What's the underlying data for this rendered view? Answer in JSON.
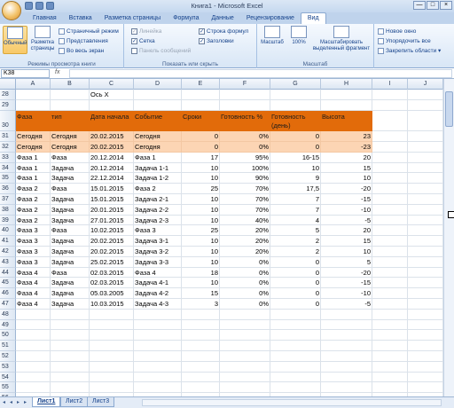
{
  "window": {
    "title": "Книга1 - Microsoft Excel",
    "controls": [
      "—",
      "□",
      "×"
    ]
  },
  "tabs": [
    "Главная",
    "Вставка",
    "Разметка страницы",
    "Формула",
    "Данные",
    "Рецензирование",
    "Вид"
  ],
  "active_tab": "Вид",
  "ribbon": {
    "views": {
      "normal": "Обычный",
      "page_layout": "Разметка страницы",
      "page_mode": "Страничный режим",
      "presentations": "Представления",
      "full_screen": "Во весь экран",
      "group": "Режимы просмотра книги"
    },
    "show": {
      "ruler": "Линейка",
      "grid": "Сетка",
      "messages": "Панель сообщений",
      "formula_bar": "Строка формул",
      "headings": "Заголовки",
      "group": "Показать или скрыть"
    },
    "zoom": {
      "zoom": "Масштаб",
      "hundred": "100%",
      "zoom_sel": "Масштабировать выделенный фрагмент",
      "group": "Масштаб"
    },
    "window": {
      "new": "Новое окно",
      "arrange": "Упорядочить все",
      "freeze": "Закрепить области ▾"
    }
  },
  "namebox": "K38",
  "columns": [
    "A",
    "B",
    "C",
    "D",
    "E",
    "F",
    "G",
    "H",
    "I",
    "J"
  ],
  "rows": [
    {
      "n": "28",
      "cells": [
        "",
        "",
        "Ось X",
        "",
        "",
        "",
        "",
        "",
        ""
      ],
      "style": ""
    },
    {
      "n": "29",
      "cells": [
        "",
        "",
        "",
        "",
        "",
        "",
        "",
        "",
        ""
      ],
      "style": ""
    },
    {
      "n": "30",
      "cells": [
        "Фаза",
        "тип",
        "Дата начала",
        "Событие",
        "Сроки",
        "Готовность %",
        "Готовность (день)",
        "Высота",
        ""
      ],
      "style": "hdr"
    },
    {
      "n": "31",
      "cells": [
        "Сегодня",
        "Сегодня",
        "20.02.2015",
        "Сегодня",
        "0",
        "0%",
        "0",
        "23",
        ""
      ],
      "style": "pk"
    },
    {
      "n": "32",
      "cells": [
        "Сегодня",
        "Сегодня",
        "20.02.2015",
        "Сегодня",
        "0",
        "0%",
        "0",
        "-23",
        ""
      ],
      "style": "pk"
    },
    {
      "n": "33",
      "cells": [
        "Фаза 1",
        "Фаза",
        "20.12.2014",
        "Фаза 1",
        "17",
        "95%",
        "16-15",
        "20",
        ""
      ],
      "style": ""
    },
    {
      "n": "34",
      "cells": [
        "Фаза 1",
        "Задача",
        "20.12.2014",
        "Задача 1-1",
        "10",
        "100%",
        "10",
        "15",
        ""
      ],
      "style": ""
    },
    {
      "n": "35",
      "cells": [
        "Фаза 1",
        "Задача",
        "22.12.2014",
        "Задача 1-2",
        "10",
        "90%",
        "9",
        "10",
        ""
      ],
      "style": ""
    },
    {
      "n": "36",
      "cells": [
        "Фаза 2",
        "Фаза",
        "15.01.2015",
        "Фаза 2",
        "25",
        "70%",
        "17,5",
        "-20",
        ""
      ],
      "style": ""
    },
    {
      "n": "37",
      "cells": [
        "Фаза 2",
        "Задача",
        "15.01.2015",
        "Задача 2-1",
        "10",
        "70%",
        "7",
        "-15",
        ""
      ],
      "style": ""
    },
    {
      "n": "38",
      "cells": [
        "Фаза 2",
        "Задача",
        "20.01.2015",
        "Задача 2-2",
        "10",
        "70%",
        "7",
        "-10",
        ""
      ],
      "style": ""
    },
    {
      "n": "39",
      "cells": [
        "Фаза 2",
        "Задача",
        "27.01.2015",
        "Задача 2-3",
        "10",
        "40%",
        "4",
        "-5",
        ""
      ],
      "style": ""
    },
    {
      "n": "40",
      "cells": [
        "Фаза 3",
        "Фаза",
        "10.02.2015",
        "Фаза 3",
        "25",
        "20%",
        "5",
        "20",
        ""
      ],
      "style": ""
    },
    {
      "n": "41",
      "cells": [
        "Фаза 3",
        "Задача",
        "20.02.2015",
        "Задача 3-1",
        "10",
        "20%",
        "2",
        "15",
        ""
      ],
      "style": ""
    },
    {
      "n": "42",
      "cells": [
        "Фаза 3",
        "Задача",
        "20.02.2015",
        "Задача 3-2",
        "10",
        "20%",
        "2",
        "10",
        ""
      ],
      "style": ""
    },
    {
      "n": "43",
      "cells": [
        "Фаза 3",
        "Задача",
        "25.02.2015",
        "Задача 3-3",
        "10",
        "0%",
        "0",
        "5",
        ""
      ],
      "style": ""
    },
    {
      "n": "44",
      "cells": [
        "Фаза 4",
        "Фаза",
        "02.03.2015",
        "Фаза 4",
        "18",
        "0%",
        "0",
        "-20",
        ""
      ],
      "style": ""
    },
    {
      "n": "45",
      "cells": [
        "Фаза 4",
        "Задача",
        "02.03.2015",
        "Задача 4-1",
        "10",
        "0%",
        "0",
        "-15",
        ""
      ],
      "style": ""
    },
    {
      "n": "46",
      "cells": [
        "Фаза 4",
        "Задача",
        "05.03.2005",
        "Задача 4-2",
        "15",
        "0%",
        "0",
        "-10",
        ""
      ],
      "style": ""
    },
    {
      "n": "47",
      "cells": [
        "Фаза 4",
        "Задача",
        "10.03.2015",
        "Задача 4-3",
        "3",
        "0%",
        "0",
        "-5",
        ""
      ],
      "style": ""
    },
    {
      "n": "48",
      "cells": [
        "",
        "",
        "",
        "",
        "",
        "",
        "",
        "",
        ""
      ],
      "style": ""
    },
    {
      "n": "49",
      "cells": [
        "",
        "",
        "",
        "",
        "",
        "",
        "",
        "",
        ""
      ],
      "style": ""
    },
    {
      "n": "50",
      "cells": [
        "",
        "",
        "",
        "",
        "",
        "",
        "",
        "",
        ""
      ],
      "style": ""
    },
    {
      "n": "51",
      "cells": [
        "",
        "",
        "",
        "",
        "",
        "",
        "",
        "",
        ""
      ],
      "style": ""
    },
    {
      "n": "52",
      "cells": [
        "",
        "",
        "",
        "",
        "",
        "",
        "",
        "",
        ""
      ],
      "style": ""
    },
    {
      "n": "53",
      "cells": [
        "",
        "",
        "",
        "",
        "",
        "",
        "",
        "",
        ""
      ],
      "style": ""
    },
    {
      "n": "54",
      "cells": [
        "",
        "",
        "",
        "",
        "",
        "",
        "",
        "",
        ""
      ],
      "style": ""
    },
    {
      "n": "55",
      "cells": [
        "",
        "",
        "",
        "",
        "",
        "",
        "",
        "",
        ""
      ],
      "style": ""
    },
    {
      "n": "56",
      "cells": [
        "",
        "",
        "",
        "",
        "",
        "",
        "",
        "",
        ""
      ],
      "style": ""
    }
  ],
  "sheets": [
    "Лист1",
    "Лист2",
    "Лист3"
  ],
  "active_sheet": "Лист1"
}
